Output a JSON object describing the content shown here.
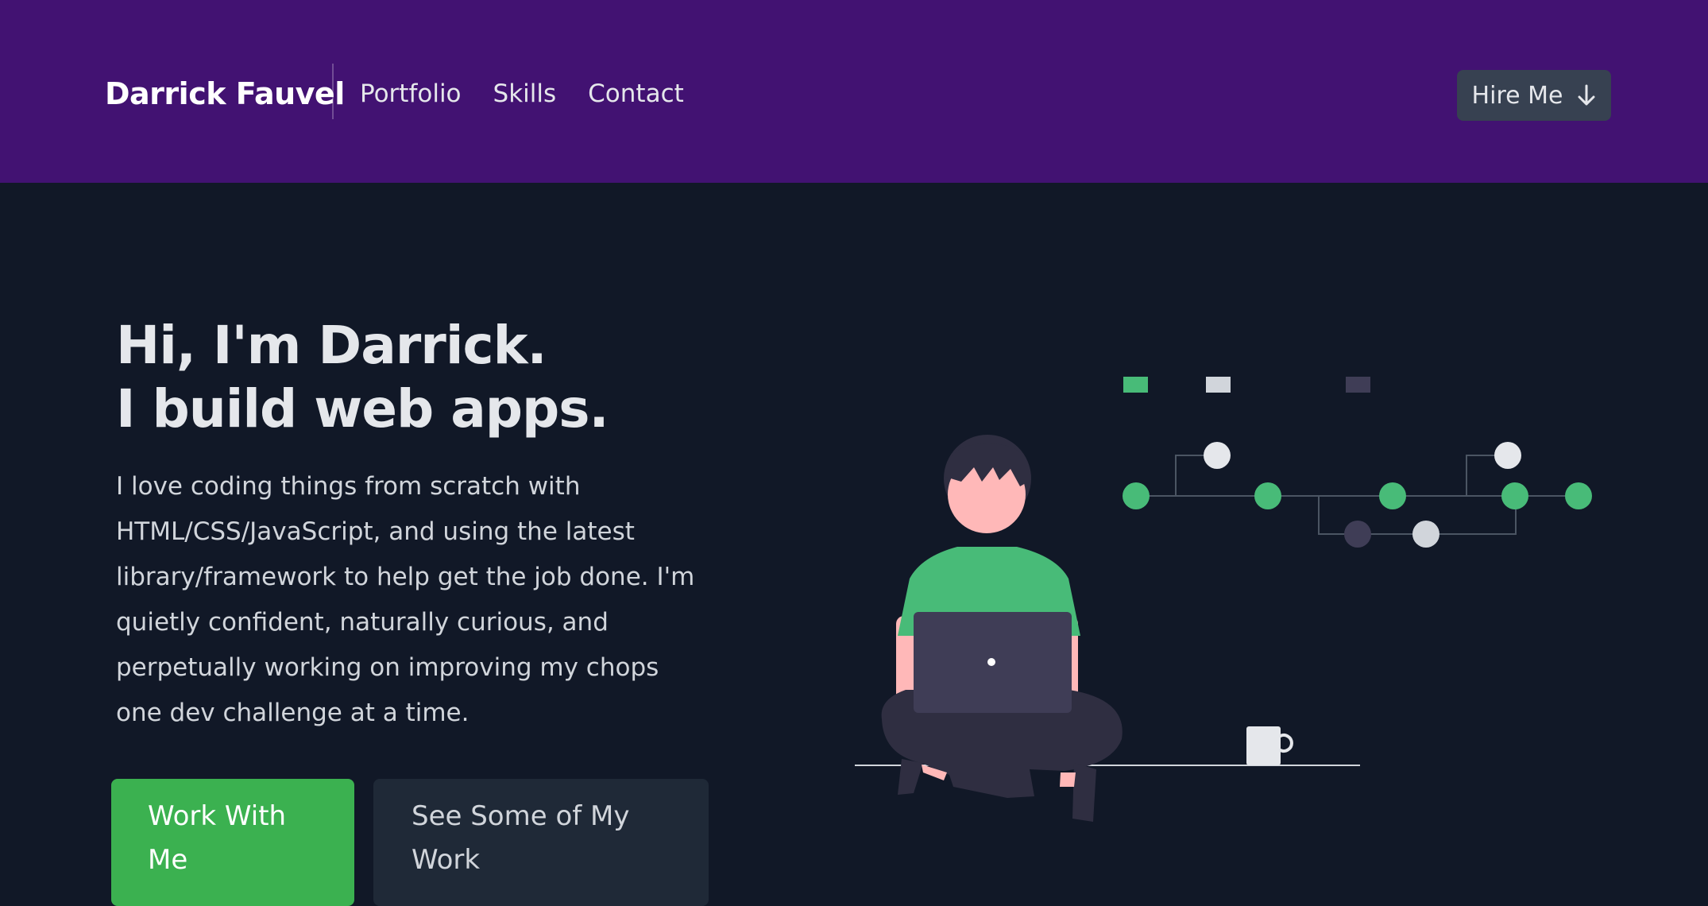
{
  "nav": {
    "brand": "Darrick Fauvel",
    "links": [
      "Portfolio",
      "Skills",
      "Contact"
    ],
    "hire_label": "Hire Me"
  },
  "hero": {
    "title_line1": "Hi, I'm Darrick.",
    "title_line2": "I build web apps.",
    "description": "I love coding things from scratch with HTML/CSS/JavaScript, and using the latest library/framework to help get the job done. I'm quietly confident, naturally curious, and perpetually working on improving my chops one dev challenge at a time.",
    "primary_button": "Work With Me",
    "secondary_button": "See Some of My Work"
  },
  "colors": {
    "nav_bg": "#421272",
    "page_bg": "#111827",
    "accent_green": "#3bb150",
    "button_dark": "#1f2937",
    "hire_bg": "#374151"
  },
  "icons": {
    "hire": "arrow-down-icon"
  }
}
